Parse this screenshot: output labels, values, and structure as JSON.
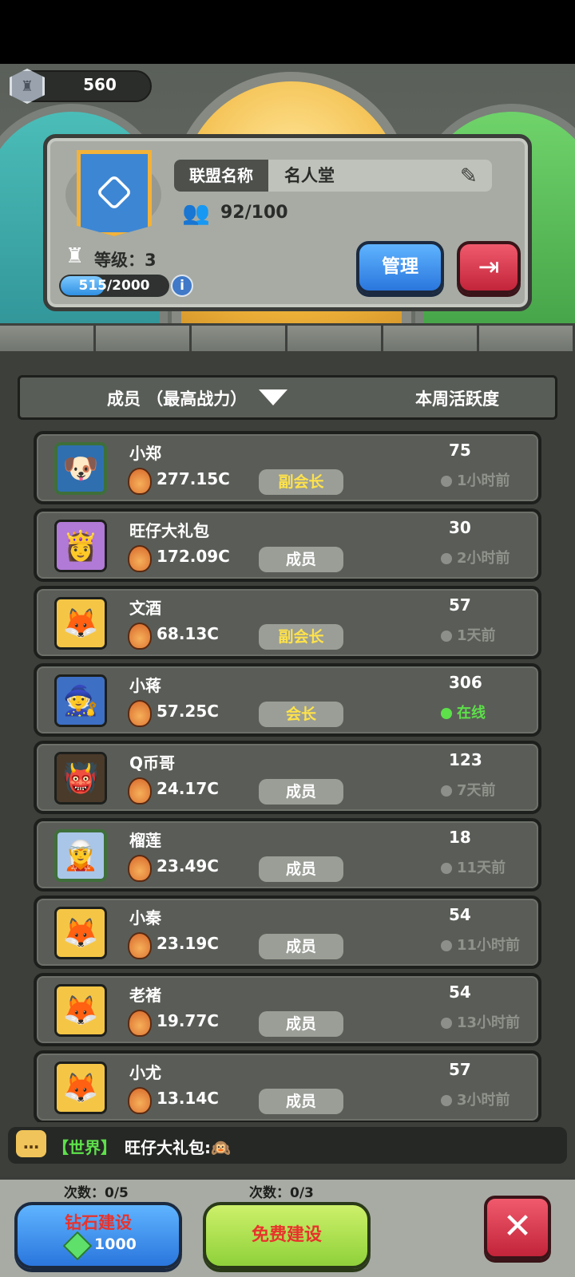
{
  "header": {
    "rank_value": "560"
  },
  "alliance": {
    "name_label": "联盟名称",
    "name": "名人堂",
    "members": "92/100",
    "level_text": "等级：3",
    "xp_text": "515/2000",
    "xp_progress": 0.2575,
    "info_glyph": "i",
    "manage_label": "管理"
  },
  "list_header": {
    "members_sort": "成员 （最高战力）",
    "activity_label": "本周活跃度"
  },
  "members": [
    {
      "name": "小郑",
      "power": "277.15C",
      "role": "副会长",
      "activity": "75",
      "last_seen": "1小时前",
      "online": false
    },
    {
      "name": "旺仔大礼包",
      "power": "172.09C",
      "role": "成员",
      "activity": "30",
      "last_seen": "2小时前",
      "online": false
    },
    {
      "name": "文酒",
      "power": "68.13C",
      "role": "副会长",
      "activity": "57",
      "last_seen": "1天前",
      "online": false
    },
    {
      "name": "小蒋",
      "power": "57.25C",
      "role": "会长",
      "activity": "306",
      "last_seen": "在线",
      "online": true
    },
    {
      "name": "Q币哥",
      "power": "24.17C",
      "role": "成员",
      "activity": "123",
      "last_seen": "7天前",
      "online": false
    },
    {
      "name": "榴莲",
      "power": "23.49C",
      "role": "成员",
      "activity": "18",
      "last_seen": "11天前",
      "online": false
    },
    {
      "name": "小秦",
      "power": "23.19C",
      "role": "成员",
      "activity": "54",
      "last_seen": "11小时前",
      "online": false
    },
    {
      "name": "老褚",
      "power": "19.77C",
      "role": "成员",
      "activity": "54",
      "last_seen": "13小时前",
      "online": false
    },
    {
      "name": "小尤",
      "power": "13.14C",
      "role": "成员",
      "activity": "57",
      "last_seen": "3小时前",
      "online": false
    }
  ],
  "chat": {
    "channel": "【世界】",
    "message": "旺仔大礼包:🙉"
  },
  "bottom": {
    "diamond_count": "次数：0/5",
    "diamond_label": "钻石建设",
    "diamond_cost": "1000",
    "free_count": "次数：0/3",
    "free_label": "免费建设",
    "close_glyph": "✕"
  }
}
